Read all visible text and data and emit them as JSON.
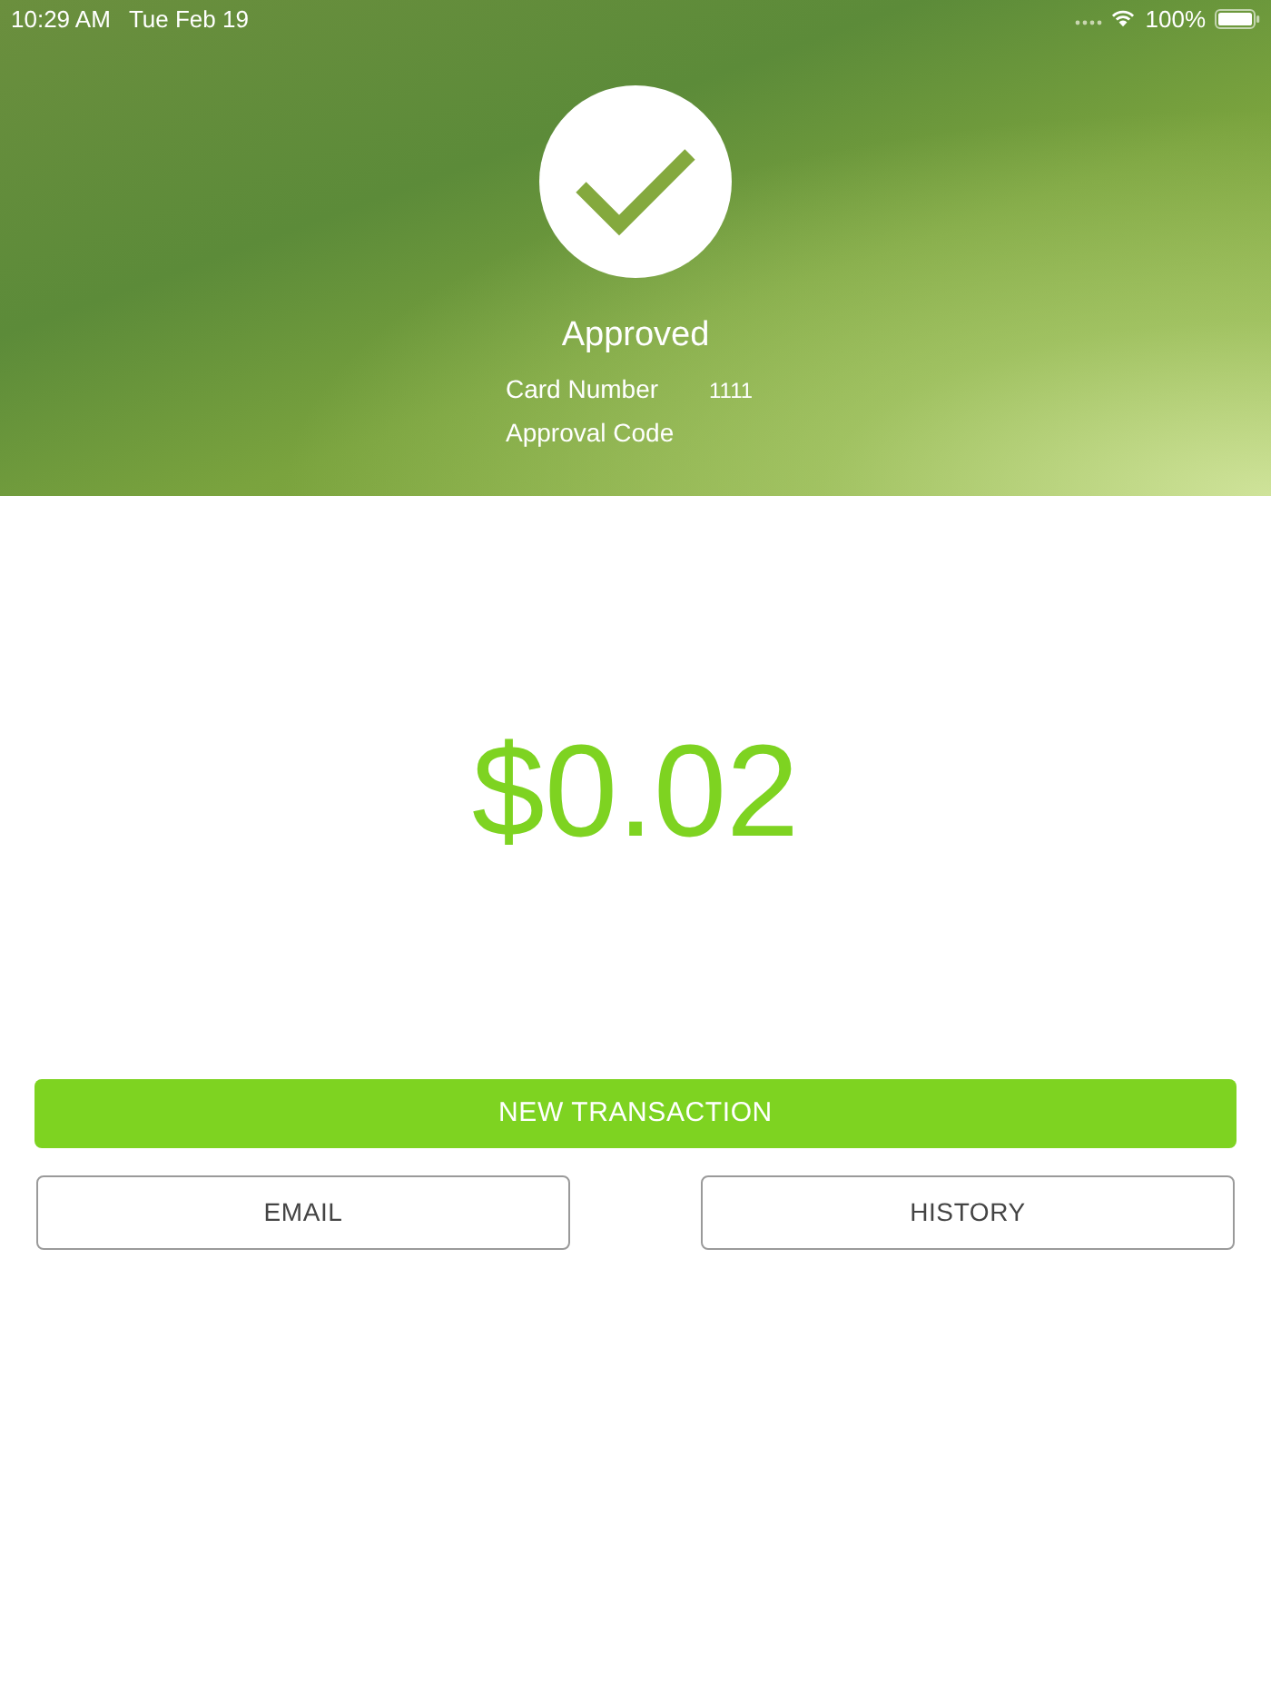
{
  "status_bar": {
    "time": "10:29 AM",
    "date": "Tue Feb 19",
    "battery": "100%"
  },
  "result": {
    "status": "Approved",
    "details": [
      {
        "label": "Card Number",
        "value": "1111"
      },
      {
        "label": "Approval Code"
      }
    ]
  },
  "amount": "$0.02",
  "buttons": [
    {
      "label": "NEW TRANSACTION",
      "kind": "primary"
    },
    {
      "label": "EMAIL",
      "kind": "outline"
    },
    {
      "label": "HISTORY",
      "kind": "outline"
    }
  ]
}
